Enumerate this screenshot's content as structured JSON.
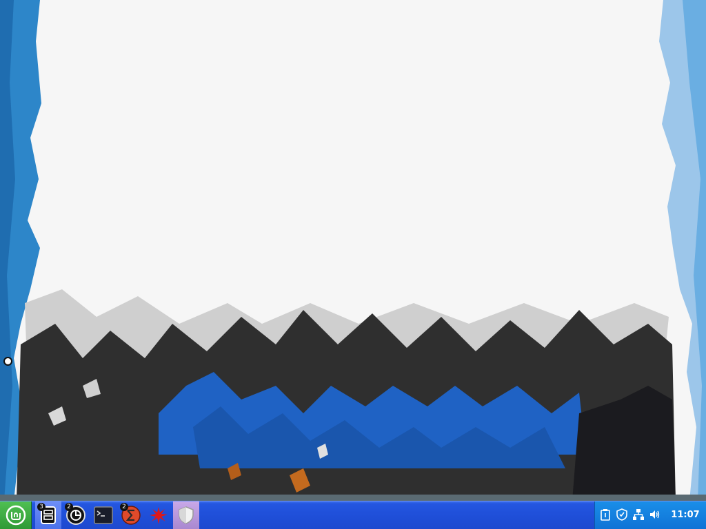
{
  "desktop": {
    "wallpaper_colors": {
      "sky": "#f6f6f6",
      "water_left": "#2d86c9",
      "water_right": "#9cc6ea",
      "rock_dark": "#2f2f2f",
      "rock_blue": "#1f62c4",
      "rock_black": "#1b1b1f",
      "rock_grey": "#cfcfcf"
    }
  },
  "taskbar": {
    "color": "#1f4fd9",
    "start": {
      "icon": "linux-mint-icon",
      "color": "#3aa83f"
    },
    "launchers": [
      {
        "icon": "file-cabinet-icon",
        "badge": "3"
      },
      {
        "icon": "disk-utility-icon",
        "badge": "2"
      },
      {
        "icon": "terminal-icon",
        "badge": ""
      },
      {
        "icon": "red-sigma-app-icon",
        "badge": "2"
      },
      {
        "icon": "red-splat-app-icon",
        "badge": ""
      },
      {
        "icon": "shield-app-icon",
        "badge": ""
      }
    ],
    "tray": {
      "icons": [
        "clipboard-icon",
        "shield-update-icon",
        "network-icon",
        "volume-icon"
      ],
      "clock": "11:07"
    }
  }
}
